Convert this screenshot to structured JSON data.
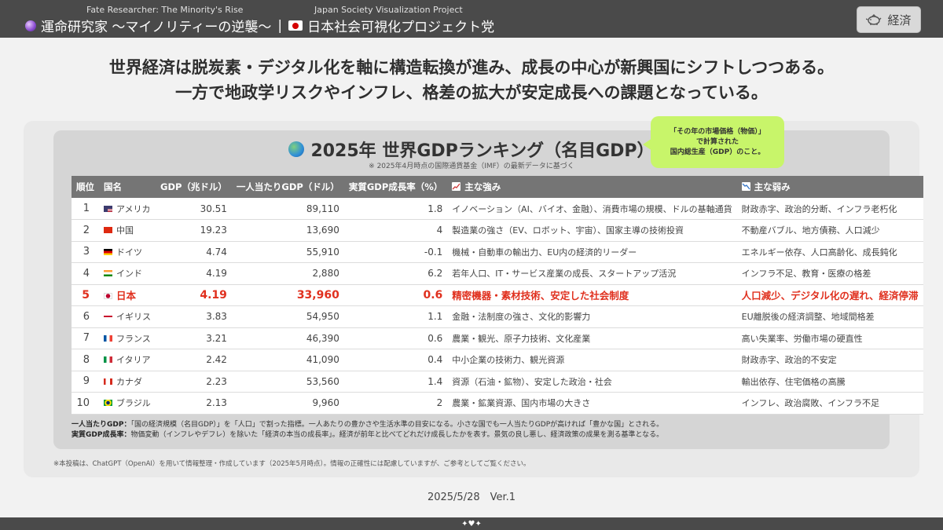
{
  "header": {
    "brand_en_left": "Fate Researcher: The Minority's Rise",
    "brand_en_right": "Japan Society Visualization Project",
    "brand_jp_left": "運命研究家 〜マイノリティーの逆襲〜",
    "separator": "|",
    "brand_jp_right": "日本社会可視化プロジェクト党",
    "category_button": "経済"
  },
  "headline": {
    "line1": "世界経済は脱炭素・デジタル化を軸に構造転換が進み、成長の中心が新興国にシフトしつつある。",
    "line2": "一方で地政学リスクやインフレ、格差の拡大が安定成長への課題となっている。"
  },
  "table": {
    "title": "2025年 世界GDPランキング（名目GDP）",
    "subtitle": "※ 2025年4月時点の国際通貨基金（IMF）の最新データに基づく",
    "bubble": [
      "「その年の市場価格（物価）」",
      "で計算された",
      "国内総生産（GDP）のこと。"
    ],
    "columns": [
      "順位",
      "国名",
      "GDP（兆ドル）",
      "一人当たりGDP（ドル）",
      "実質GDP成長率（%）",
      "主な強み",
      "主な弱み"
    ],
    "rows": [
      {
        "rank": "1",
        "country": "アメリカ",
        "flag": "us",
        "gdp": "30.51",
        "per_capita": "89,110",
        "growth": "1.8",
        "strength": "イノベーション（AI、バイオ、金融）、消費市場の規模、ドルの基軸通貨",
        "weakness": "財政赤字、政治的分断、インフラ老朽化"
      },
      {
        "rank": "2",
        "country": "中国",
        "flag": "cn",
        "gdp": "19.23",
        "per_capita": "13,690",
        "growth": "4",
        "strength": "製造業の強さ（EV、ロボット、宇宙）、国家主導の技術投資",
        "weakness": "不動産バブル、地方債務、人口減少"
      },
      {
        "rank": "3",
        "country": "ドイツ",
        "flag": "de",
        "gdp": "4.74",
        "per_capita": "55,910",
        "growth": "-0.1",
        "strength": "機械・自動車の輸出力、EU内の経済的リーダー",
        "weakness": "エネルギー依存、人口高齢化、成長鈍化"
      },
      {
        "rank": "4",
        "country": "インド",
        "flag": "in",
        "gdp": "4.19",
        "per_capita": "2,880",
        "growth": "6.2",
        "strength": "若年人口、IT・サービス産業の成長、スタートアップ活況",
        "weakness": "インフラ不足、教育・医療の格差"
      },
      {
        "rank": "5",
        "country": "日本",
        "flag": "jp",
        "gdp": "4.19",
        "per_capita": "33,960",
        "growth": "0.6",
        "strength": "精密機器・素材技術、安定した社会制度",
        "weakness": "人口減少、デジタル化の遅れ、経済停滞",
        "highlight": true
      },
      {
        "rank": "6",
        "country": "イギリス",
        "flag": "uk",
        "gdp": "3.83",
        "per_capita": "54,950",
        "growth": "1.1",
        "strength": "金融・法制度の強さ、文化的影響力",
        "weakness": "EU離脱後の経済調整、地域間格差"
      },
      {
        "rank": "7",
        "country": "フランス",
        "flag": "fr",
        "gdp": "3.21",
        "per_capita": "46,390",
        "growth": "0.6",
        "strength": "農業・観光、原子力技術、文化産業",
        "weakness": "高い失業率、労働市場の硬直性"
      },
      {
        "rank": "8",
        "country": "イタリア",
        "flag": "it",
        "gdp": "2.42",
        "per_capita": "41,090",
        "growth": "0.4",
        "strength": "中小企業の技術力、観光資源",
        "weakness": "財政赤字、政治的不安定"
      },
      {
        "rank": "9",
        "country": "カナダ",
        "flag": "ca",
        "gdp": "2.23",
        "per_capita": "53,560",
        "growth": "1.4",
        "strength": "資源（石油・鉱物）、安定した政治・社会",
        "weakness": "輸出依存、住宅価格の高騰"
      },
      {
        "rank": "10",
        "country": "ブラジル",
        "flag": "br",
        "gdp": "2.13",
        "per_capita": "9,960",
        "growth": "2",
        "strength": "農業・鉱業資源、国内市場の大きさ",
        "weakness": "インフレ、政治腐敗、インフラ不足"
      }
    ]
  },
  "notes": {
    "per_capita_term": "一人当たりGDP：",
    "per_capita_text": "「国の経済規模（名目GDP）」を「人口」で割った指標。一人あたりの豊かさや生活水準の目安になる。小さな国でも一人当たりGDPが高ければ「豊かな国」とされる。",
    "growth_term": "実質GDP成長率：",
    "growth_text": "物価変動（インフレやデフレ）を除いた「経済の本当の成長率」。経済が前年と比べてどれだけ成長したかを表す。景気の良し悪し、経済政策の成果を測る基準となる。"
  },
  "disclaimer": "※本投稿は、ChatGPT（OpenAI）を用いて情報整理・作成しています（2025年5月時点）。情報の正確性には配慮していますが、ご参考としてご覧ください。",
  "footer": {
    "date_version": "2025/5/28　Ver.1"
  },
  "colors": {
    "bar": "#4a4a4a",
    "highlight": "#e0301e",
    "bubble": "#c8f56a"
  }
}
